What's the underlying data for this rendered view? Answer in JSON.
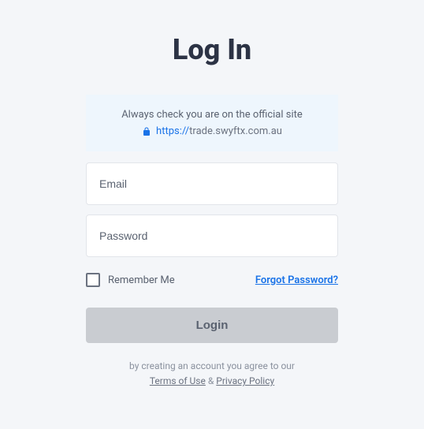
{
  "page": {
    "title": "Log In"
  },
  "banner": {
    "warning": "Always check you are on the official site",
    "url_scheme": "https://",
    "url_domain": "trade.swyftx.com.au"
  },
  "form": {
    "email_placeholder": "Email",
    "password_placeholder": "Password",
    "remember_label": "Remember Me",
    "forgot_label": "Forgot Password?",
    "submit_label": "Login"
  },
  "footer": {
    "prefix": "by creating an account you agree to our",
    "terms_label": "Terms of Use",
    "amp": "&",
    "privacy_label": "Privacy Policy"
  }
}
